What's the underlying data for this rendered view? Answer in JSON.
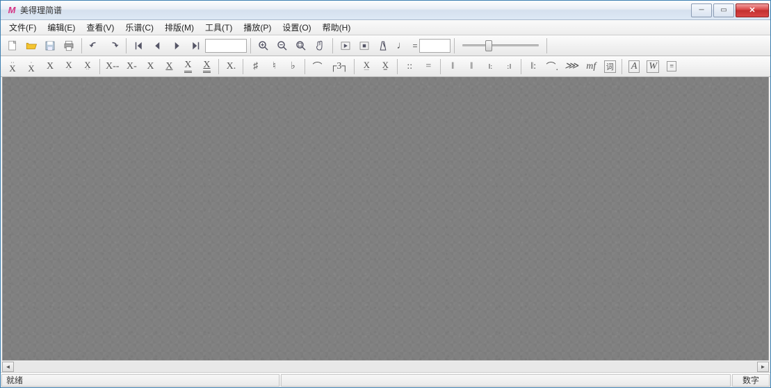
{
  "window": {
    "title": "美得理简谱",
    "app_icon_letter": "M"
  },
  "win_controls": {
    "minimize": "─",
    "maximize": "▭",
    "close": "✕"
  },
  "menubar": [
    "文件(F)",
    "编辑(E)",
    "查看(V)",
    "乐谱(C)",
    "排版(M)",
    "工具(T)",
    "播放(P)",
    "设置(O)",
    "帮助(H)"
  ],
  "toolbar1": {
    "new": "new-icon",
    "open": "open-icon",
    "save": "save-icon",
    "print": "print-icon",
    "undo": "undo-icon",
    "redo": "redo-icon",
    "nav_first": "first-icon",
    "nav_prev": "prev-icon",
    "nav_next": "next-icon",
    "nav_last": "last-icon",
    "page_input": "",
    "zoom_in": "zoom-in-icon",
    "zoom_out": "zoom-out-icon",
    "zoom_fit": "zoom-fit-icon",
    "hand": "hand-icon",
    "play": "play-icon",
    "stop": "stop-icon",
    "metronome": "metronome-icon",
    "tempo_note": "♩",
    "tempo_eq": "=",
    "tempo_value": ""
  },
  "toolbar2": {
    "note_buttons": [
      "X̄̄",
      "X̄",
      "X",
      "X̱",
      "X̱̱",
      "X―",
      "X-",
      "X̲",
      "X̲̲",
      "X̲̲̲",
      "X.",
      "♯",
      "♮",
      "♭"
    ],
    "phrase_buttons": [
      "⌒",
      "┌3┐"
    ],
    "accent_buttons": [
      "X͟",
      "X͟͟"
    ],
    "dynamic_buttons": [
      "::",
      "="
    ],
    "bar_buttons": [
      "‖",
      "‖",
      "𝄆",
      "𝄇"
    ],
    "end_buttons": [
      "‖:",
      "⌒",
      "𝄞",
      "𝑚𝑓"
    ],
    "text_buttons": [
      "词",
      "A",
      "W",
      "≡"
    ]
  },
  "statusbar": {
    "left": "就绪",
    "right": "数字"
  }
}
